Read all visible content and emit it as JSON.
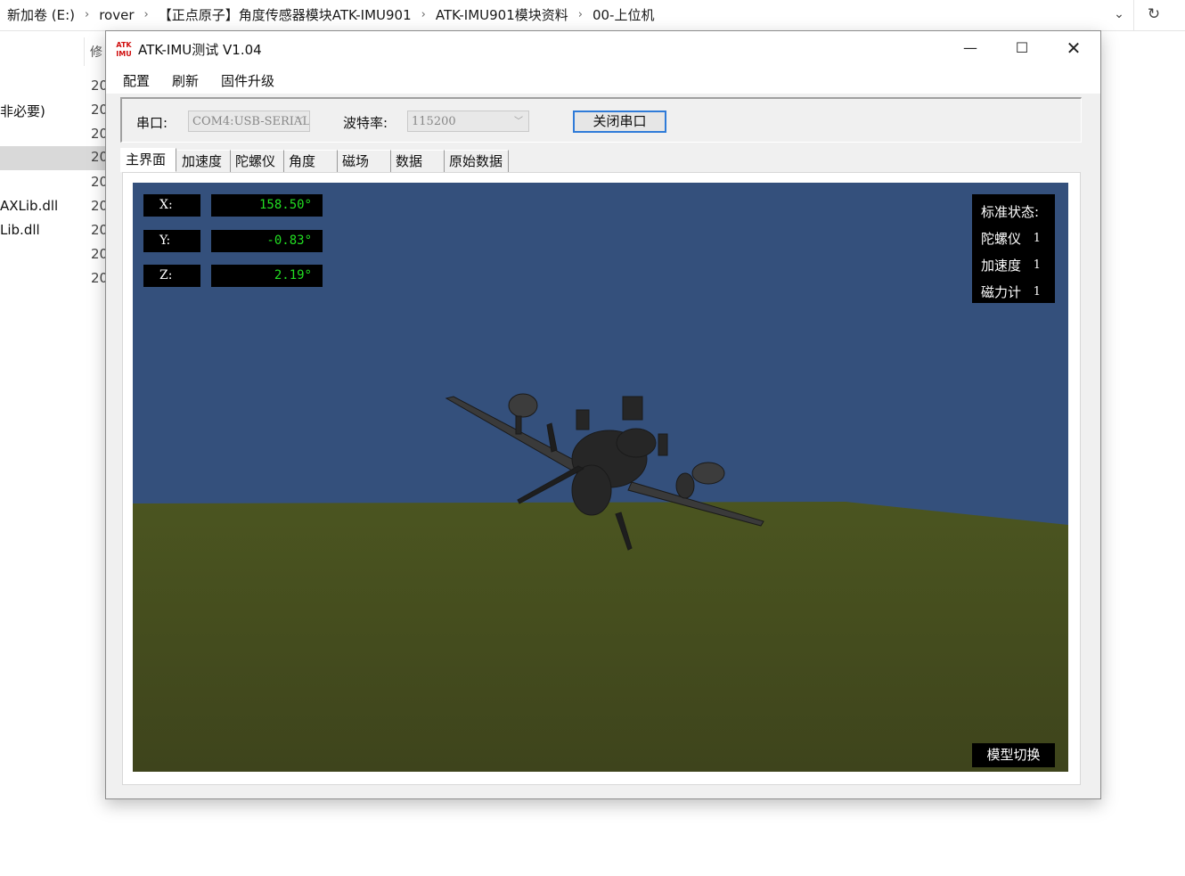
{
  "explorer": {
    "breadcrumb": [
      "新加卷 (E:)",
      "rover",
      "【正点原子】角度传感器模块ATK-IMU901",
      "ATK-IMU901模块资料",
      "00-上位机"
    ],
    "column_header": "修",
    "rows": [
      {
        "name": "",
        "date": "20"
      },
      {
        "name": "非必要)",
        "date": "20"
      },
      {
        "name": "",
        "date": "20"
      },
      {
        "name": "",
        "date": "20"
      },
      {
        "name": "",
        "date": "20"
      },
      {
        "name": "AXLib.dll",
        "date": "20"
      },
      {
        "name": "Lib.dll",
        "date": "20"
      },
      {
        "name": "",
        "date": "20"
      },
      {
        "name": "",
        "date": "20"
      }
    ]
  },
  "app": {
    "logo_text": "ATK IMU",
    "title": "ATK-IMU测试 V1.04",
    "menu": [
      "配置",
      "刷新",
      "固件升级"
    ],
    "serial": {
      "port_label": "串口:",
      "port_value": "COM4:USB-SERIAL",
      "baud_label": "波特率:",
      "baud_value": "115200",
      "close_button": "关闭串口"
    },
    "tabs": [
      "主界面",
      "加速度",
      "陀螺仪",
      "角度",
      "磁场",
      "数据",
      "原始数据"
    ],
    "active_tab": "主界面",
    "angles": [
      {
        "label": "X:",
        "value": "158.50°"
      },
      {
        "label": "Y:",
        "value": "-0.83°"
      },
      {
        "label": "Z:",
        "value": "2.19°"
      }
    ],
    "status": {
      "title": "标准状态:",
      "items": [
        {
          "label": "陀螺仪",
          "value": "1"
        },
        {
          "label": "加速度",
          "value": "1"
        },
        {
          "label": "磁力计",
          "value": "1"
        }
      ]
    },
    "model_switch": "模型切换",
    "colors": {
      "sky": "#34507c",
      "ground": "#4a5226",
      "angle_text": "#22dd22",
      "focus_border": "#2f7bd8"
    }
  }
}
